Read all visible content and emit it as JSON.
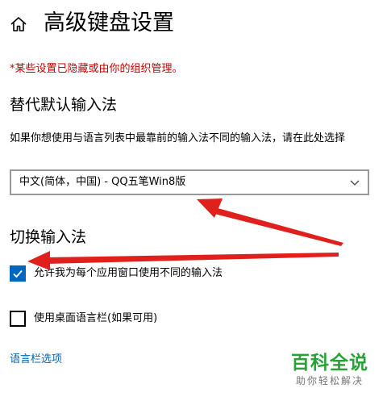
{
  "header": {
    "home_icon": "home-icon",
    "title": "高级键盘设置"
  },
  "notice": {
    "text": "*某些设置已隐藏或由你的组织管理。",
    "color": "#c50000"
  },
  "override_section": {
    "heading": "替代默认输入法",
    "description": "如果你想使用与语言列表中最靠前的输入法不同的输入法，请在此处选择",
    "selected_value": "中文(简体，中国) - QQ五笔Win8版",
    "dropdown_icon": "chevron-down-icon"
  },
  "switch_section": {
    "heading": "切换输入法",
    "options": [
      {
        "label": "允许我为每个应用窗口使用不同的输入法",
        "checked": true
      },
      {
        "label": "使用桌面语言栏(如果可用)",
        "checked": false
      }
    ],
    "link": "语言栏选项"
  },
  "colors": {
    "accent": "#0067c0",
    "link": "#0063b1",
    "annotation_arrow": "#e0201c"
  },
  "watermark": {
    "brand": "百科全说",
    "slogan": "助你轻松解决"
  }
}
